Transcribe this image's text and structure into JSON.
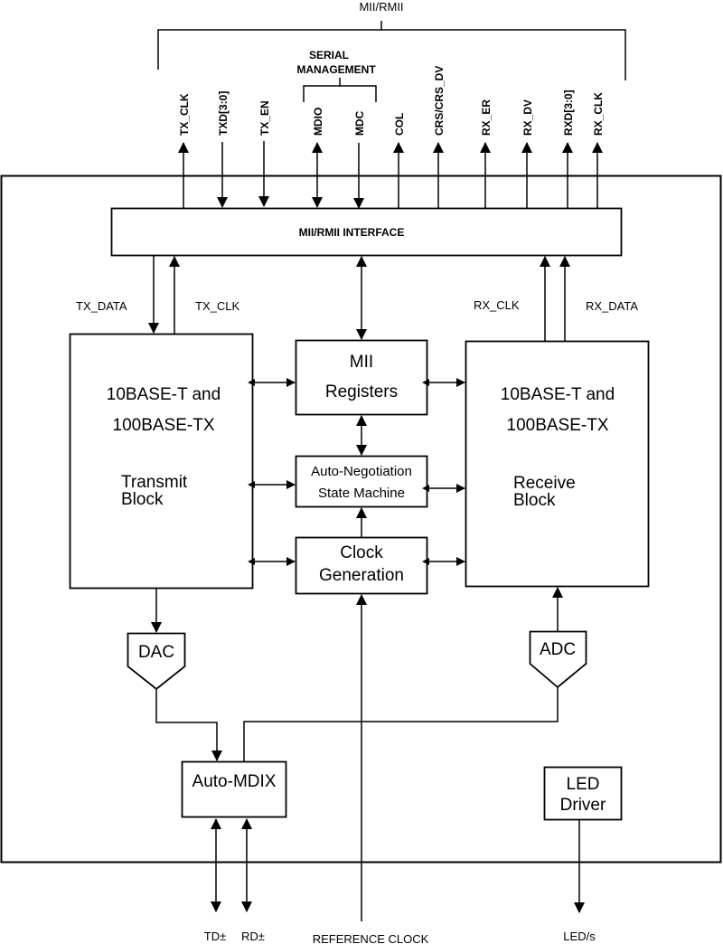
{
  "bus": {
    "title": "MII/RMII",
    "serial_group": [
      "SERIAL",
      "MANAGEMENT"
    ],
    "signals": [
      {
        "name": "TX_CLK",
        "direction": "out"
      },
      {
        "name": "TXD[3:0]",
        "direction": "in"
      },
      {
        "name": "TX_EN",
        "direction": "in"
      },
      {
        "name": "MDIO",
        "direction": "bidirectional"
      },
      {
        "name": "MDC",
        "direction": "in"
      },
      {
        "name": "COL",
        "direction": "out"
      },
      {
        "name": "CRS/CRS_DV",
        "direction": "out"
      },
      {
        "name": "RX_ER",
        "direction": "out"
      },
      {
        "name": "RX_DV",
        "direction": "out"
      },
      {
        "name": "RXD[3:0]",
        "direction": "out"
      },
      {
        "name": "RX_CLK",
        "direction": "out"
      }
    ]
  },
  "blocks": {
    "interface": "MII/RMII INTERFACE",
    "transmit": {
      "line1": "10BASE-T and",
      "line2": "100BASE-TX",
      "line3": "Transmit",
      "line4": "Block"
    },
    "receive": {
      "line1": "10BASE-T and",
      "line2": "100BASE-TX",
      "line3": "Receive",
      "line4": "Block"
    },
    "mii_registers": {
      "line1": "MII",
      "line2": "Registers"
    },
    "auto_negotiation": {
      "line1": "Auto-Negotiation",
      "line2": "State Machine"
    },
    "clock_generation": {
      "line1": "Clock",
      "line2": "Generation"
    },
    "dac": "DAC",
    "adc": "ADC",
    "auto_mdix": "Auto-MDIX",
    "led_driver": {
      "line1": "LED",
      "line2": "Driver"
    }
  },
  "internal_labels": {
    "tx_data": "TX_DATA",
    "tx_clk": "TX_CLK",
    "rx_clk": "RX_CLK",
    "rx_data": "RX_DATA"
  },
  "external_pins": {
    "td": "TD±",
    "rd": "RD±",
    "reference_clock": "REFERENCE CLOCK",
    "leds": "LED/s"
  }
}
